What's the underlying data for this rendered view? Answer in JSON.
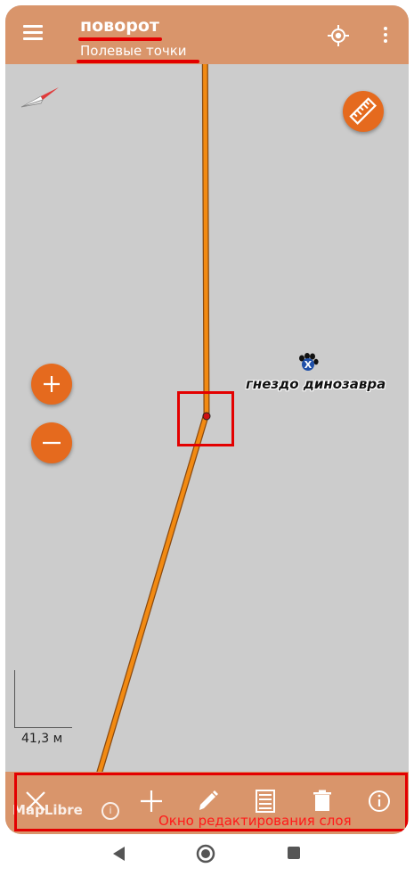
{
  "app_bar": {
    "title": "поворот",
    "subtitle": "Полевые точки",
    "menu_icon": "hamburger-menu-icon",
    "gps_icon": "gps-locate-icon",
    "more_icon": "more-vert-icon"
  },
  "map": {
    "poi_label": "гнездо динозавра",
    "poi_icon": "paw-marker-icon",
    "scale_label": "41,3 м",
    "compass_icon": "compass-needle-icon",
    "ruler_icon": "ruler-icon",
    "zoom_in_icon": "plus-icon",
    "zoom_out_icon": "minus-icon",
    "track_color": "#f28a12"
  },
  "edit_bar": {
    "caption": "Окно редактирования слоя",
    "maplibre_text": "MapLibre",
    "maplibre_info": "i",
    "tools": [
      "close-icon",
      "add-icon",
      "edit-pencil-icon",
      "attributes-list-icon",
      "delete-icon",
      "info-icon"
    ]
  },
  "nav_bar": {
    "back_icon": "back-triangle-icon",
    "home_icon": "home-circle-icon",
    "recent_icon": "recent-square-icon"
  },
  "colors": {
    "accent_orange": "#e56a1e",
    "bar_tan": "#d9956b",
    "annotation_red": "#e30000",
    "map_background": "#cccccc"
  }
}
